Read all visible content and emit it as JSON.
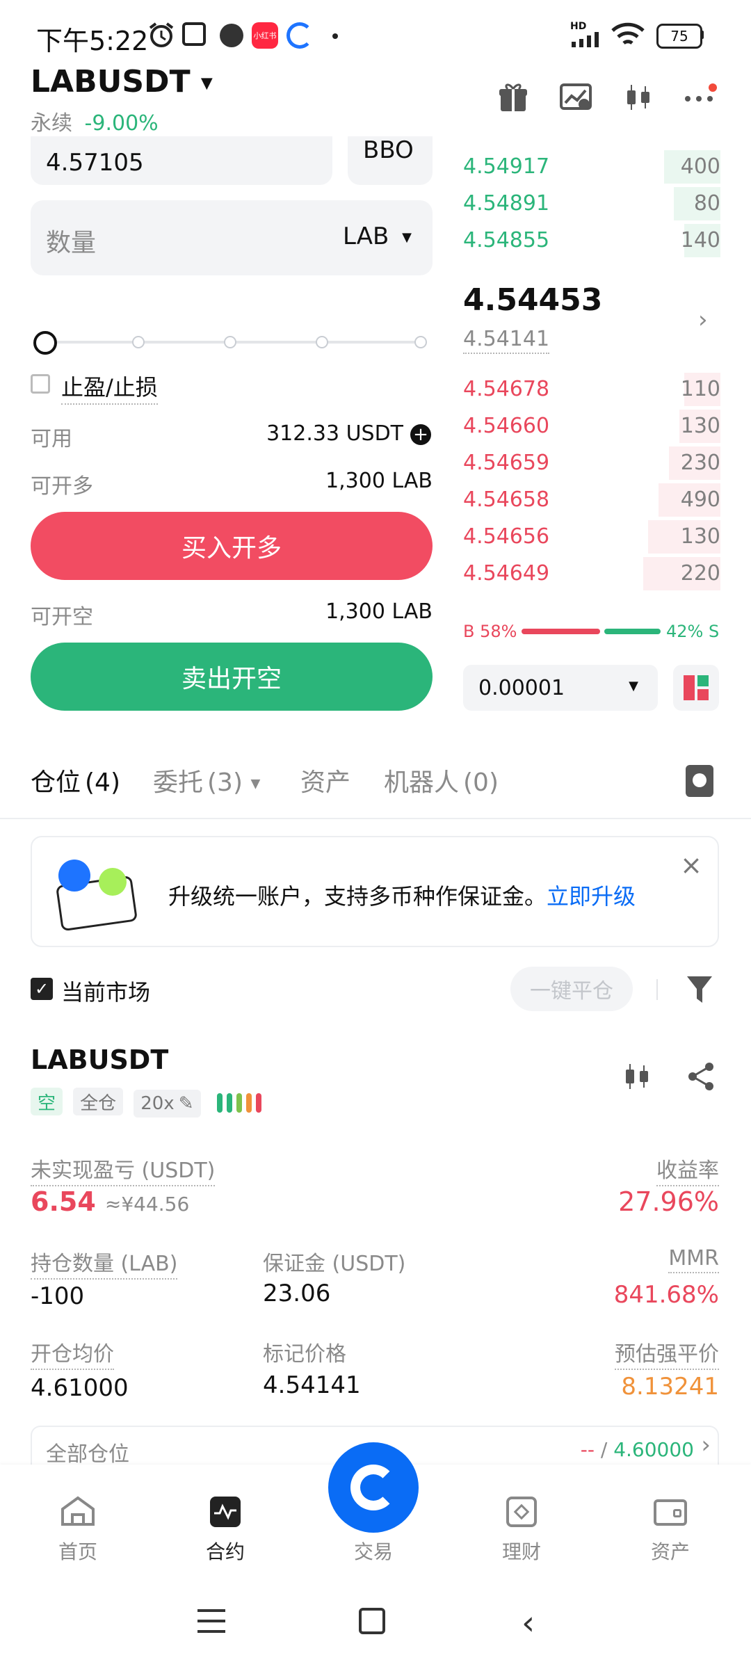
{
  "status_bar": {
    "time": "下午5:22",
    "network": "HD",
    "battery": "75",
    "app_icons": [
      "alarm-icon",
      "nfc-icon",
      "camera-app-icon",
      "xiaohongshu-icon",
      "compass-app-icon",
      "dot-icon"
    ],
    "xhs_label": "小红书"
  },
  "header": {
    "symbol": "LABUSDT",
    "contract_type": "永续",
    "change": "-9.00%",
    "icons": [
      "gift-icon",
      "chart-card-icon",
      "candlestick-icon",
      "more-icon"
    ]
  },
  "order_form": {
    "price_value": "4.57105",
    "bbo_label": "BBO",
    "quantity_placeholder": "数量",
    "quantity_unit": "LAB",
    "slider_value": 0,
    "tpsl_label": "止盈/止损",
    "available_label": "可用",
    "available_value": "312.33 USDT",
    "can_long_label": "可开多",
    "can_long_value": "1,300 LAB",
    "buy_button": "买入开多",
    "can_short_label": "可开空",
    "can_short_value": "1,300 LAB",
    "sell_button": "卖出开空"
  },
  "order_book": {
    "asks_top": [
      {
        "price": "4.54917",
        "qty": "400",
        "depth": 0.22
      },
      {
        "price": "4.54891",
        "qty": "80",
        "depth": 0.18
      },
      {
        "price": "4.54855",
        "qty": "140",
        "depth": 0.14
      }
    ],
    "last_price": "4.54453",
    "mark_price": "4.54141",
    "bids": [
      {
        "price": "4.54678",
        "qty": "110",
        "depth": 0.14
      },
      {
        "price": "4.54660",
        "qty": "130",
        "depth": 0.16
      },
      {
        "price": "4.54659",
        "qty": "230",
        "depth": 0.2
      },
      {
        "price": "4.54658",
        "qty": "490",
        "depth": 0.24
      },
      {
        "price": "4.54656",
        "qty": "130",
        "depth": 0.28
      },
      {
        "price": "4.54649",
        "qty": "220",
        "depth": 0.3
      }
    ],
    "buy_ratio_label": "B 58%",
    "sell_ratio_label": "42% S",
    "buy_ratio": 0.58,
    "precision": "0.00001"
  },
  "tabs": {
    "positions": "仓位",
    "positions_count": "(4)",
    "orders": "委托",
    "orders_count": "(3)",
    "assets": "资产",
    "robots": "机器人",
    "robots_count": "(0)"
  },
  "banner": {
    "text": "升级统一账户，支持多币种作保证金。",
    "link": "立即升级"
  },
  "filter": {
    "current_market": "当前市场",
    "close_all": "一键平仓"
  },
  "position": {
    "symbol": "LABUSDT",
    "side_tag": "空",
    "margin_mode": "全仓",
    "leverage": "20x",
    "unrealized_pnl_label": "未实现盈亏 (USDT)",
    "unrealized_pnl": "6.54",
    "unrealized_pnl_cny": "≈¥44.56",
    "roe_label": "收益率",
    "roe": "27.96%",
    "size_label": "持仓数量 (LAB)",
    "size": "-100",
    "margin_label": "保证金 (USDT)",
    "margin": "23.06",
    "mmr_label": "MMR",
    "mmr": "841.68%",
    "entry_label": "开仓均价",
    "entry": "4.61000",
    "mark_label": "标记价格",
    "mark": "4.54141",
    "liq_label": "预估强平价",
    "liq": "8.13241",
    "all_positions_label": "全部仓位",
    "all_positions_left": "--",
    "all_positions_sep": " / ",
    "all_positions_right": "4.60000"
  },
  "bottom_nav": {
    "home": "首页",
    "futures": "合约",
    "trade": "交易",
    "earn": "理财",
    "assets": "资产"
  },
  "colors": {
    "green": "#2bb57a",
    "red": "#e9475c",
    "orange": "#f0923a",
    "blue": "#0a6cf5"
  }
}
